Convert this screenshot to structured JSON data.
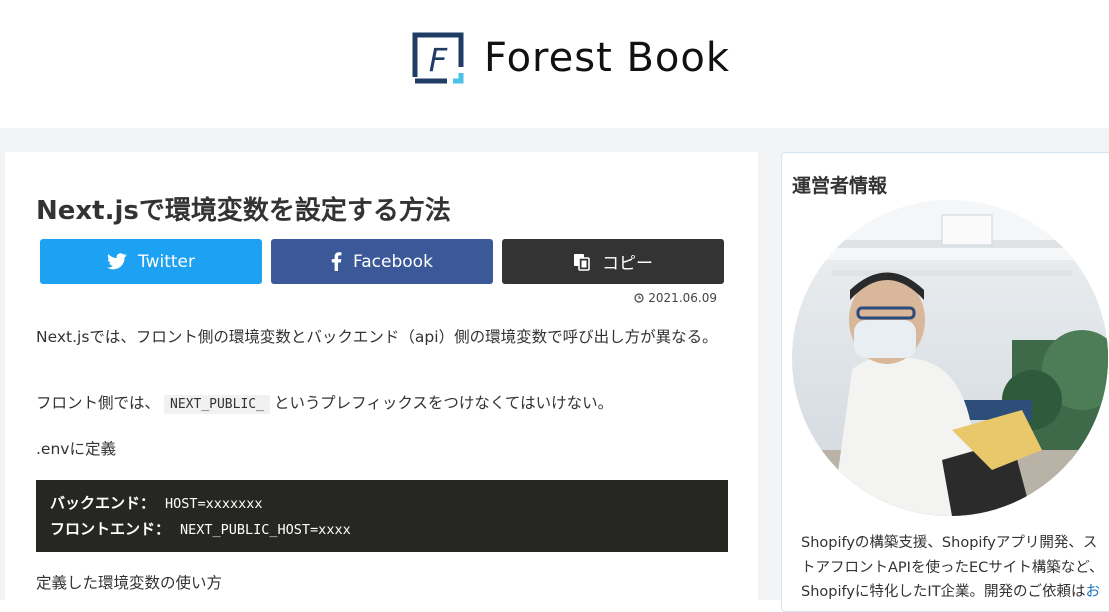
{
  "site": {
    "name": "Forest Book",
    "logo_letter": "F"
  },
  "post": {
    "title": "Next.jsで環境変数を設定する方法",
    "date": "2021.06.09",
    "share": {
      "twitter": "Twitter",
      "facebook": "Facebook",
      "copy": "コピー"
    },
    "p1": "Next.jsでは、フロント側の環境変数とバックエンド（api）側の環境変数で呼び出し方が異なる。",
    "p2_before": "フロント側では、",
    "p2_code": "NEXT_PUBLIC_",
    "p2_after": "というプレフィックスをつけなくてはいけない。",
    "p3": ".envに定義",
    "code": [
      {
        "key": "バックエンド：",
        "value": "HOST=xxxxxxx"
      },
      {
        "key": "フロントエンド：",
        "value": "NEXT_PUBLIC_HOST=xxxx"
      }
    ],
    "p4": "定義した環境変数の使い方"
  },
  "sidebar": {
    "title": "運営者情報",
    "bio": "Shopifyの構築支援、Shopifyアプリ開発、ストアフロントAPIを使ったECサイト構築など、Shopifyに特化したIT企業。開発のご依頼は",
    "bio_link": "お"
  },
  "colors": {
    "twitter": "#1da1f2",
    "facebook": "#3b5998",
    "copy": "#333333",
    "code_bg": "#262622",
    "logo_blue": "#1f3c64",
    "logo_cyan": "#4cc2e8",
    "link": "#1e73be"
  }
}
